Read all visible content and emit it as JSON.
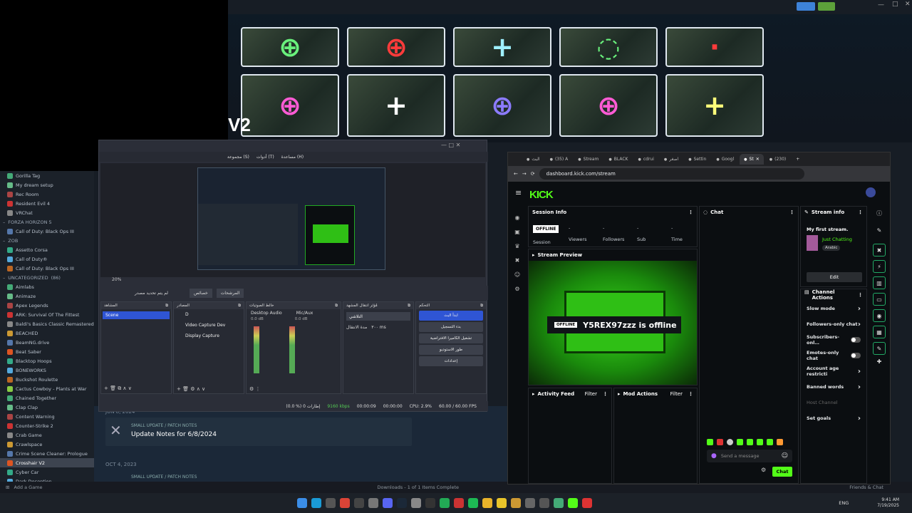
{
  "crosshair_title": "V2",
  "steam": {
    "library_items": [
      {
        "label": "Gorilla Tag",
        "type": "item"
      },
      {
        "label": "My dream setup",
        "type": "item"
      },
      {
        "label": "Rec Room",
        "type": "item"
      },
      {
        "label": "Resident Evil 4",
        "type": "item"
      },
      {
        "label": "VRChat",
        "type": "item"
      },
      {
        "label": "FORZA HORIZON 5",
        "type": "header"
      },
      {
        "label": "Call of Duty: Black Ops III",
        "type": "item"
      },
      {
        "label": "ZOB",
        "type": "header"
      },
      {
        "label": "Assetto Corsa",
        "type": "item"
      },
      {
        "label": "Call of Duty®",
        "type": "item"
      },
      {
        "label": "Call of Duty: Black Ops III",
        "type": "item"
      },
      {
        "label": "UNCATEGORIZED",
        "type": "header",
        "count": "(86)"
      },
      {
        "label": "Aimlabs",
        "type": "item"
      },
      {
        "label": "Animaze",
        "type": "item"
      },
      {
        "label": "Apex Legends",
        "type": "item"
      },
      {
        "label": "ARK: Survival Of The Fittest",
        "type": "item"
      },
      {
        "label": "Baldi's Basics Classic Remastered",
        "type": "item"
      },
      {
        "label": "BEACHED",
        "type": "item"
      },
      {
        "label": "BeamNG.drive",
        "type": "item"
      },
      {
        "label": "Beat Saber",
        "type": "item"
      },
      {
        "label": "Blacktop Hoops",
        "type": "item"
      },
      {
        "label": "BONEWORKS",
        "type": "item"
      },
      {
        "label": "Buckshot Roulette",
        "type": "item"
      },
      {
        "label": "Cactus Cowboy - Plants at War",
        "type": "item"
      },
      {
        "label": "Chained Together",
        "type": "item"
      },
      {
        "label": "Clap Clap",
        "type": "item"
      },
      {
        "label": "Content Warning",
        "type": "item"
      },
      {
        "label": "Counter-Strike 2",
        "type": "item"
      },
      {
        "label": "Crab Game",
        "type": "item"
      },
      {
        "label": "Crawlspace",
        "type": "item"
      },
      {
        "label": "Crime Scene Cleaner: Prologue",
        "type": "item"
      },
      {
        "label": "Crosshair V2",
        "type": "item",
        "selected": true
      },
      {
        "label": "Cyber Car",
        "type": "item"
      },
      {
        "label": "Dark Deception",
        "type": "item"
      }
    ],
    "date1": "JUN 8, 2024",
    "update_tag": "SMALL UPDATE / PATCH NOTES",
    "update_title": "Update Notes for 6/8/2024",
    "date2": "OCT 4, 2023",
    "update_tag2": "SMALL UPDATE / PATCH NOTES",
    "add_game": "Add a Game",
    "downloads": "Downloads - 1 of 1 Items Complete",
    "friends": "Friends & Chat"
  },
  "obs": {
    "menu": [
      "مجموعة (S)",
      "أدوات (T)",
      "مساعدة (H)"
    ],
    "zoom": "20%",
    "preview_btn": "لم يتم تحديد مصدر",
    "props_btn": "خصائص",
    "filters_btn": "المرشحات",
    "docks": {
      "scenes": "المشاهد",
      "sources": "المصادر",
      "mixer": "خالط الصوتيات",
      "transitions": "مُؤثر انتقال المشهد",
      "controls": "التحكم"
    },
    "scene_item": "Scene",
    "source_items": [
      "D",
      "Video Capture Dev",
      "Display Capture"
    ],
    "mixer_channels": [
      {
        "name": "Desktop Audio",
        "db": "0.0 dB"
      },
      {
        "name": "Mic/Aux",
        "db": "0.0 dB"
      }
    ],
    "transition": "التلاشي",
    "duration_label": "مدة الانتقال",
    "duration": "٣٠٠ ms",
    "controls": [
      "ابدأ البث",
      "بدء التسجيل",
      "تشغيل الكاميرا الافتراضية",
      "طور الاستوديو",
      "إعدادات"
    ],
    "status": {
      "frames": "(0.0 %) 0 إطارات",
      "bitrate": "9160 kbps",
      "rec": "00:00:09",
      "stream": "00:00:00",
      "cpu": "CPU: 2.9%",
      "fps": "60.00 / 60.00 FPS"
    }
  },
  "browser": {
    "tabs": [
      "البث",
      "(35) A",
      "Stream",
      "BLACK",
      "cdrui",
      "اصغر",
      "Settin",
      "Googl",
      "St",
      "(230)"
    ],
    "url": "dashboard.kick.com/stream",
    "logo": "KICK",
    "session": {
      "title": "Session Info",
      "badge": "OFFLINE",
      "session_label": "Session",
      "stats": [
        {
          "value": "-",
          "label": "Viewers"
        },
        {
          "value": "-",
          "label": "Followers"
        },
        {
          "value": "-",
          "label": "Sub"
        },
        {
          "value": "-",
          "label": "Time"
        }
      ]
    },
    "preview": {
      "title": "Stream Preview",
      "offline_badge": "OFFLINE",
      "offline_text": "Y5REX97zzz is offline"
    },
    "activity": {
      "title": "Activity Feed",
      "filter": "Filter"
    },
    "mod": {
      "title": "Mod Actions",
      "filter": "Filter"
    },
    "chat": {
      "title": "Chat",
      "placeholder": "Send a message",
      "send": "Chat"
    },
    "stream_info": {
      "title": "Stream info",
      "stream_title": "My first stream.",
      "category": "Just Chatting",
      "language": "Arabic",
      "edit": "Edit"
    },
    "channel_actions": {
      "title": "Channel Actions",
      "items": [
        {
          "label": "Slow mode",
          "control": "chevron"
        },
        {
          "label": "Followers-only chat",
          "control": "chevron"
        },
        {
          "label": "Subscribers-onl…",
          "control": "toggle"
        },
        {
          "label": "Emotes-only chat",
          "control": "toggle"
        },
        {
          "label": "Account age restricti",
          "control": "chevron"
        },
        {
          "label": "Banned words",
          "control": "chevron"
        },
        {
          "label": "Host Channel",
          "control": "none",
          "disabled": true
        },
        {
          "label": "Set goals",
          "control": "chevron"
        }
      ]
    }
  },
  "taskbar": {
    "lang": "ENG",
    "time": "9:41 AM",
    "date": "7/19/2025"
  },
  "colors": {
    "kick_green": "#53fc18",
    "steam_bg": "#171d25",
    "obs_blue": "#2f55d4",
    "crosshair_green": "#69f07c",
    "crosshair_red": "#ff3b3b",
    "crosshair_cyan": "#9ff0ff",
    "crosshair_pink": "#ff5bd5",
    "crosshair_purple": "#8c7bff",
    "crosshair_yellow": "#ffff7a"
  }
}
